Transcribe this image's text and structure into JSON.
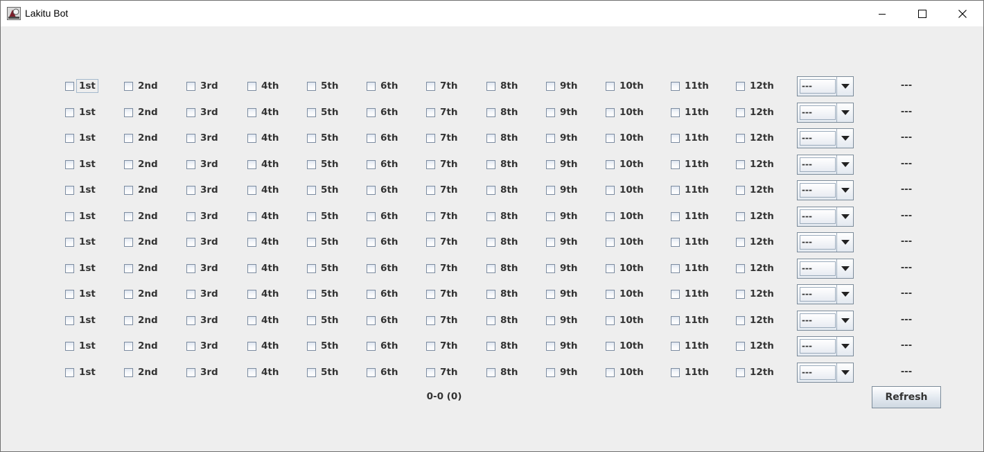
{
  "window": {
    "title": "Lakitu Bot",
    "controls": [
      "minimize-icon",
      "maximize-icon",
      "close-icon"
    ]
  },
  "option_labels": [
    "1st",
    "2nd",
    "3rd",
    "4th",
    "5th",
    "6th",
    "7th",
    "8th",
    "9th",
    "10th",
    "11th",
    "12th"
  ],
  "rows": [
    {
      "checked": [
        false,
        false,
        false,
        false,
        false,
        false,
        false,
        false,
        false,
        false,
        false,
        false
      ],
      "selected": "---",
      "result": "---"
    },
    {
      "checked": [
        false,
        false,
        false,
        false,
        false,
        false,
        false,
        false,
        false,
        false,
        false,
        false
      ],
      "selected": "---",
      "result": "---"
    },
    {
      "checked": [
        false,
        false,
        false,
        false,
        false,
        false,
        false,
        false,
        false,
        false,
        false,
        false
      ],
      "selected": "---",
      "result": "---"
    },
    {
      "checked": [
        false,
        false,
        false,
        false,
        false,
        false,
        false,
        false,
        false,
        false,
        false,
        false
      ],
      "selected": "---",
      "result": "---"
    },
    {
      "checked": [
        false,
        false,
        false,
        false,
        false,
        false,
        false,
        false,
        false,
        false,
        false,
        false
      ],
      "selected": "---",
      "result": "---"
    },
    {
      "checked": [
        false,
        false,
        false,
        false,
        false,
        false,
        false,
        false,
        false,
        false,
        false,
        false
      ],
      "selected": "---",
      "result": "---"
    },
    {
      "checked": [
        false,
        false,
        false,
        false,
        false,
        false,
        false,
        false,
        false,
        false,
        false,
        false
      ],
      "selected": "---",
      "result": "---"
    },
    {
      "checked": [
        false,
        false,
        false,
        false,
        false,
        false,
        false,
        false,
        false,
        false,
        false,
        false
      ],
      "selected": "---",
      "result": "---"
    },
    {
      "checked": [
        false,
        false,
        false,
        false,
        false,
        false,
        false,
        false,
        false,
        false,
        false,
        false
      ],
      "selected": "---",
      "result": "---"
    },
    {
      "checked": [
        false,
        false,
        false,
        false,
        false,
        false,
        false,
        false,
        false,
        false,
        false,
        false
      ],
      "selected": "---",
      "result": "---"
    },
    {
      "checked": [
        false,
        false,
        false,
        false,
        false,
        false,
        false,
        false,
        false,
        false,
        false,
        false
      ],
      "selected": "---",
      "result": "---"
    },
    {
      "checked": [
        false,
        false,
        false,
        false,
        false,
        false,
        false,
        false,
        false,
        false,
        false,
        false
      ],
      "selected": "---",
      "result": "---"
    }
  ],
  "summary": "0-0 (0)",
  "refresh_label": "Refresh",
  "colors": {
    "background": "#eeeeee",
    "text": "#333333",
    "border": "#7a8a99"
  }
}
